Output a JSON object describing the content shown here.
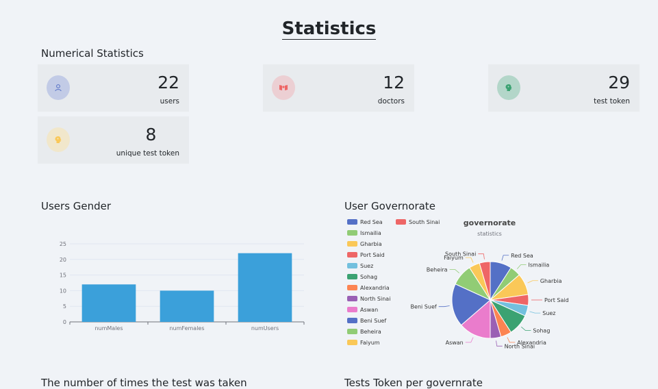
{
  "page": {
    "title": "Statistics",
    "numerical_title": "Numerical Statistics",
    "gender_title": "Users Gender",
    "governorate_title": "User Governorate",
    "times_title": "The number of times the test was taken",
    "tests_per_gov_title": "Tests Token per governrate"
  },
  "stats": [
    {
      "value": "22",
      "label": "users",
      "icon": "user-icon",
      "color": "#5470c6",
      "bg": "#c2cbe6"
    },
    {
      "value": "12",
      "label": "doctors",
      "icon": "doctor-icon",
      "color": "#ee6666",
      "bg": "#eccfd3"
    },
    {
      "value": "29",
      "label": "test token",
      "icon": "brain-icon",
      "color": "#3ba272",
      "bg": "#b3d6c9"
    },
    {
      "value": "8",
      "label": "unique test token",
      "icon": "bulb-icon",
      "color": "#fac858",
      "bg": "#f1e7cb"
    }
  ],
  "chart_data": [
    {
      "type": "bar",
      "categories": [
        "numMales",
        "numFemales",
        "numUsers"
      ],
      "values": [
        12,
        10,
        22
      ],
      "ylim": [
        0,
        25
      ],
      "yticks": [
        0,
        5,
        10,
        15,
        20,
        25
      ],
      "grid": true,
      "color": "#3ba0da"
    },
    {
      "type": "pie",
      "title": "governorate",
      "subtitle": "statistics",
      "legend_position": "top-left",
      "slices": [
        {
          "label": "Red Sea",
          "value": 2,
          "color": "#5470c6"
        },
        {
          "label": "Ismailia",
          "value": 1,
          "color": "#91cc75"
        },
        {
          "label": "Gharbia",
          "value": 2,
          "color": "#fac858"
        },
        {
          "label": "Port Said",
          "value": 1,
          "color": "#ee6666"
        },
        {
          "label": "Suez",
          "value": 1,
          "color": "#73c0de"
        },
        {
          "label": "Sohag",
          "value": 2,
          "color": "#3ba272"
        },
        {
          "label": "Alexandria",
          "value": 1,
          "color": "#fc8452"
        },
        {
          "label": "North Sinai",
          "value": 1,
          "color": "#9a60b4"
        },
        {
          "label": "Aswan",
          "value": 3,
          "color": "#ea7ccc"
        },
        {
          "label": "Beni Suef",
          "value": 4,
          "color": "#5470c6"
        },
        {
          "label": "Beheira",
          "value": 2,
          "color": "#91cc75"
        },
        {
          "label": "Faiyum",
          "value": 1,
          "color": "#fac858"
        },
        {
          "label": "South Sinai",
          "value": 1,
          "color": "#ee6666"
        }
      ]
    }
  ]
}
